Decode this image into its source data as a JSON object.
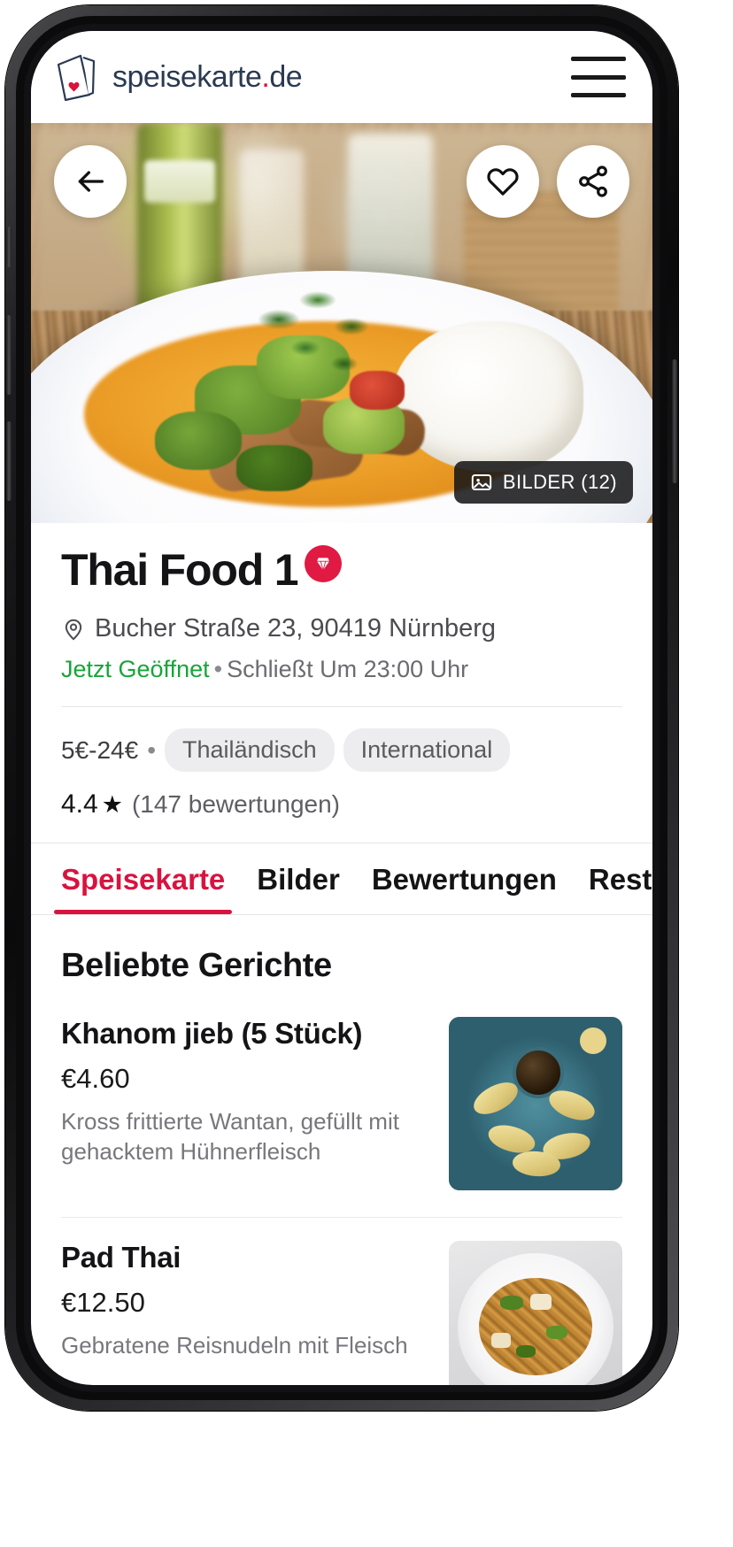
{
  "header": {
    "brand_name": "speisekarte",
    "brand_dot": ".",
    "brand_tld": "de",
    "menu_label": "Menü"
  },
  "hero": {
    "back_label": "Zurück",
    "favorite_label": "Favorit",
    "share_label": "Teilen",
    "images_badge": "BILDER (12)"
  },
  "restaurant": {
    "name": "Thai Food 1",
    "premium_badge": "Premium",
    "address": "Bucher Straße 23, 90419 Nürnberg",
    "open_status": "Jetzt Geöffnet",
    "separator": "•",
    "closing_time": "Schließt Um 23:00 Uhr",
    "price_range": "5€-24€",
    "cuisines": [
      "Thailändisch",
      "International"
    ],
    "rating_value": "4.4",
    "rating_star": "★",
    "rating_count": "(147 bewertungen)"
  },
  "tabs": [
    {
      "label": "Speisekarte",
      "active": true
    },
    {
      "label": "Bilder",
      "active": false
    },
    {
      "label": "Bewertungen",
      "active": false
    },
    {
      "label": "Resta",
      "active": false
    }
  ],
  "menu": {
    "section_title": "Beliebte Gerichte",
    "dishes": [
      {
        "name": "Khanom jieb (5 Stück)",
        "price": "€4.60",
        "description": "Kross frittierte Wantan, gefüllt mit gehacktem Hühnerfleisch"
      },
      {
        "name": "Pad Thai",
        "price": "€12.50",
        "description": "Gebratene Reisnudeln mit Fleisch"
      }
    ]
  },
  "colors": {
    "accent_red": "#d8133f",
    "brand_navy": "#2b3a52",
    "open_green": "#17a53a",
    "badge_red": "#e01a42"
  }
}
